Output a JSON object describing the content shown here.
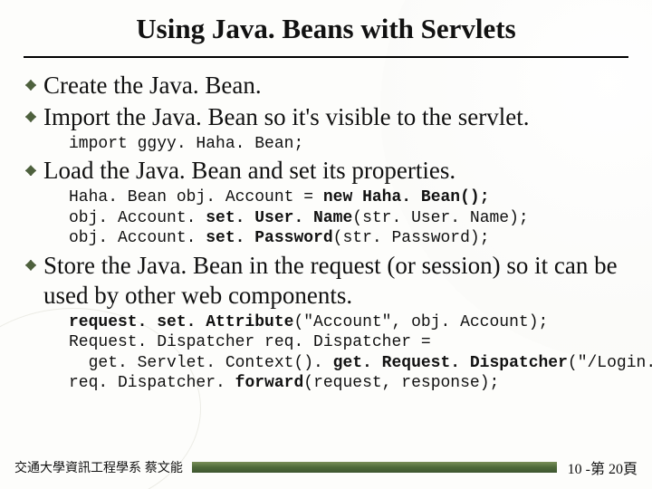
{
  "title": "Using Java. Beans with Servlets",
  "items": [
    {
      "text": "Create the Java. Bean.",
      "code_html": ""
    },
    {
      "text": "Import the Java. Bean so it's visible to the servlet.",
      "code_html": "import ggyy. Haha. Bean;"
    },
    {
      "text": "Load the Java. Bean and set its properties.",
      "code_html": "Haha. Bean obj. Account = <b>new</b> <b>Haha. Bean();</b>\nobj. Account. <b>set. User. Name</b>(str. User. Name);\nobj. Account. <b>set. Password</b>(str. Password);"
    },
    {
      "text": "Store the Java. Bean in the request (or session) so it can be used by other web components.",
      "code_html": "<b>request. set. Attribute</b>(\"Account\", obj. Account);\nRequest. Dispatcher req. Dispatcher =\n  get. Servlet. Context(). <b>get. Request. Dispatcher</b>(\"/Login. jsp\");\nreq. Dispatcher. <b>forward</b>(request, response);"
    }
  ],
  "footer": {
    "credit": "交通大學資訊工程學系 蔡文能",
    "page": "10 -第 20頁"
  }
}
